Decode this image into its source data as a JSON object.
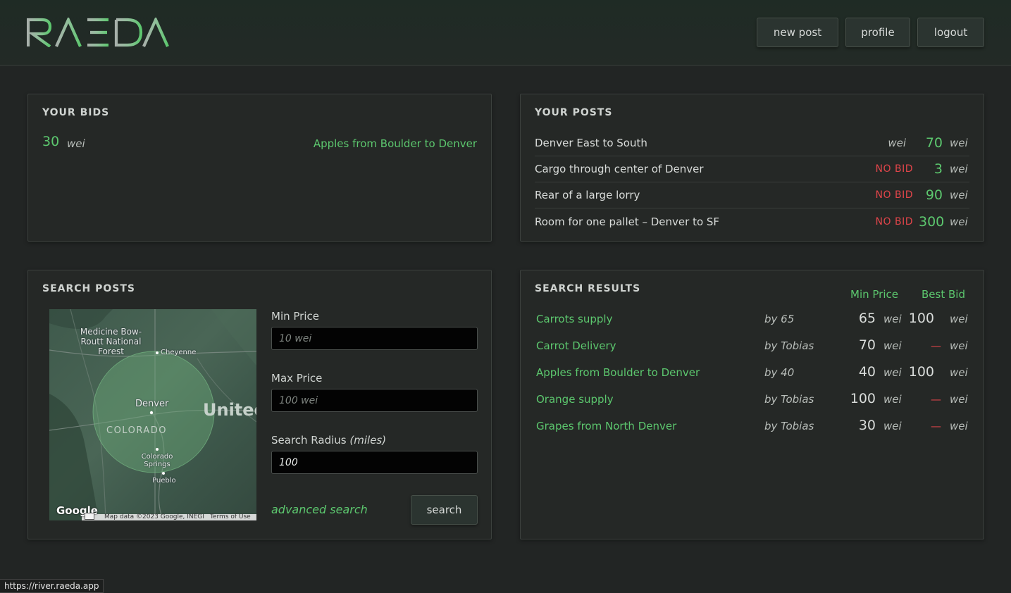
{
  "header": {
    "logo_text": "RAEDA",
    "nav": {
      "new_post": "new post",
      "profile": "profile",
      "logout": "logout"
    }
  },
  "your_bids": {
    "title": "YOUR BIDS",
    "items": [
      {
        "amount": "30",
        "unit": "wei",
        "post": "Apples from Boulder to Denver"
      }
    ]
  },
  "your_posts": {
    "title": "YOUR POSTS",
    "items": [
      {
        "title": "Denver East to South",
        "status": "",
        "status_unit": "wei",
        "price": "70",
        "unit": "wei"
      },
      {
        "title": "Cargo through center of Denver",
        "status": "NO BID",
        "status_unit": "",
        "price": "3",
        "unit": "wei"
      },
      {
        "title": "Rear of a large lorry",
        "status": "NO BID",
        "status_unit": "",
        "price": "90",
        "unit": "wei"
      },
      {
        "title": "Room for one pallet – Denver to SF",
        "status": "NO BID",
        "status_unit": "",
        "price": "300",
        "unit": "wei"
      }
    ]
  },
  "search_posts": {
    "title": "SEARCH POSTS",
    "min_price_label": "Min Price",
    "min_price_placeholder": "10 wei",
    "max_price_label": "Max Price",
    "max_price_placeholder": "100 wei",
    "radius_label": "Search Radius",
    "radius_unit": "(miles)",
    "radius_value": "100",
    "advanced_search": "advanced search",
    "search_button": "search",
    "map": {
      "labels": {
        "forest": "Medicine Bow-Routt National Forest",
        "cheyenne": "Cheyenne",
        "denver": "Denver",
        "colorado": "COLORADO",
        "united": "United",
        "springs": "Colorado Springs",
        "pueblo": "Pueblo"
      },
      "google": "Google",
      "attribution": "Map data ©2023 Google, INEGI",
      "terms": "Terms of Use"
    }
  },
  "search_results": {
    "title": "SEARCH RESULTS",
    "col_min_price": "Min Price",
    "col_best_bid": "Best Bid",
    "rows": [
      {
        "title": "Carrots supply",
        "by": "by 65",
        "min": "65",
        "min_unit": "wei",
        "bid": "100",
        "bid_unit": "wei"
      },
      {
        "title": "Carrot Delivery",
        "by": "by Tobias",
        "min": "70",
        "min_unit": "wei",
        "bid": "—",
        "bid_unit": "wei"
      },
      {
        "title": "Apples from Boulder to Denver",
        "by": "by 40",
        "min": "40",
        "min_unit": "wei",
        "bid": "100",
        "bid_unit": "wei"
      },
      {
        "title": "Orange supply",
        "by": "by Tobias",
        "min": "100",
        "min_unit": "wei",
        "bid": "—",
        "bid_unit": "wei"
      },
      {
        "title": "Grapes from North Denver",
        "by": "by Tobias",
        "min": "30",
        "min_unit": "wei",
        "bid": "—",
        "bid_unit": "wei"
      }
    ]
  },
  "status_bar": {
    "url": "https://river.raeda.app"
  },
  "colors": {
    "accent": "#5cc76e",
    "danger": "#e0454a",
    "background": "#222524"
  }
}
